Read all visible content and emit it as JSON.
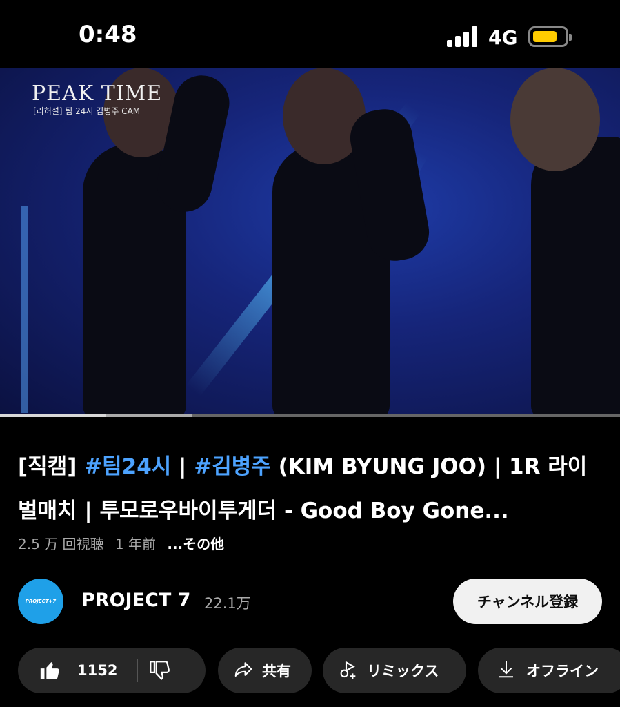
{
  "status_bar": {
    "time": "0:48",
    "network": "4G",
    "battery_color": "#ffcc00"
  },
  "video": {
    "overlay_title": "PEAK TIME",
    "overlay_subtitle": "[리허설] 팀 24시 김병주 CAM",
    "progress_played_fraction": 0.17,
    "progress_buffered_fraction": 0.31
  },
  "title": {
    "prefix": "[직캠] ",
    "tag1": "#팀24시",
    "sep1": " | ",
    "tag2": "#김병주",
    "rest": " (KIM BYUNG JOO)  | 1R 라이벌매치 | 투모로우바이투게더 - Good Boy Gone..."
  },
  "meta": {
    "views": "2.5 万 回視聴",
    "age": "1 年前",
    "more": "...その他"
  },
  "channel": {
    "avatar_text": "PROJECT+7",
    "name": "PROJECT 7",
    "subscribers": "22.1万",
    "subscribe_label": "チャンネル登録",
    "avatar_color": "#1fa0e8"
  },
  "actions": {
    "like_count": "1152",
    "share_label": "共有",
    "remix_label": "リミックス",
    "offline_label": "オフライン"
  },
  "icons": {
    "like": "thumbs-up-icon",
    "dislike": "thumbs-down-icon",
    "share": "share-arrow-icon",
    "remix": "remix-icon",
    "download": "download-icon"
  }
}
